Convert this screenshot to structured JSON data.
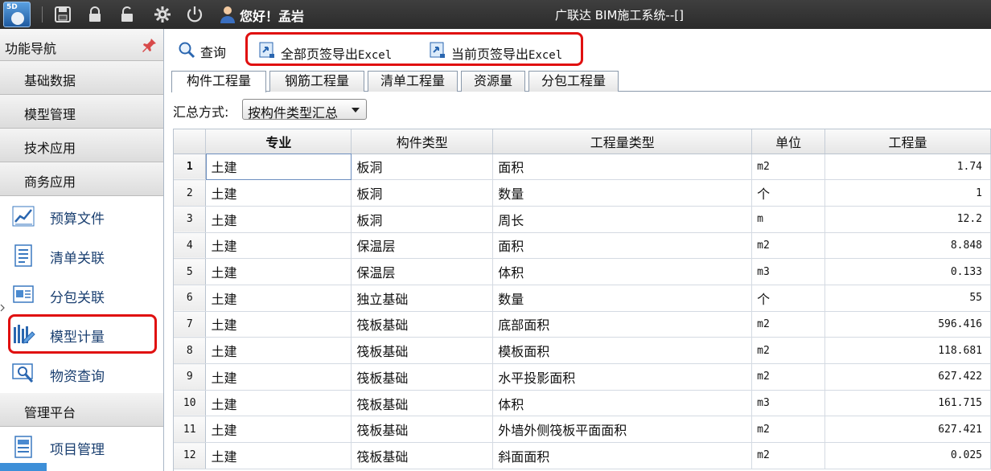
{
  "titlebar": {
    "logo_text": "5D",
    "greeting": "您好！孟岩",
    "app_title": "广联达 BIM施工系统--[]",
    "buttons": [
      "save-icon",
      "lock-icon",
      "unlock-icon",
      "gear-icon",
      "power-icon"
    ]
  },
  "sidebar": {
    "header": "功能导航",
    "sections": [
      {
        "label": "基础数据"
      },
      {
        "label": "模型管理"
      },
      {
        "label": "技术应用"
      },
      {
        "label": "商务应用"
      }
    ],
    "items": [
      {
        "label": "预算文件",
        "icon": "chart-icon"
      },
      {
        "label": "清单关联",
        "icon": "document-icon"
      },
      {
        "label": "分包关联",
        "icon": "presentation-icon"
      },
      {
        "label": "模型计量",
        "icon": "ruler-icon",
        "highlighted": true
      },
      {
        "label": "物资查询",
        "icon": "magnifier-icon"
      }
    ],
    "section2": {
      "label": "管理平台"
    },
    "items2": [
      {
        "label": "项目管理",
        "icon": "project-icon"
      }
    ]
  },
  "toolbar": {
    "query_label": "查询",
    "export_all": {
      "cn": "全部页签导出",
      "en": "Excel"
    },
    "export_current": {
      "cn": "当前页签导出",
      "en": "Excel"
    }
  },
  "tabs": [
    {
      "label": "构件工程量",
      "active": true
    },
    {
      "label": "钢筋工程量",
      "active": false
    },
    {
      "label": "清单工程量",
      "active": false
    },
    {
      "label": "资源量",
      "active": false
    },
    {
      "label": "分包工程量",
      "active": false
    }
  ],
  "filter": {
    "label": "汇总方式:",
    "selected": "按构件类型汇总"
  },
  "table": {
    "columns": [
      "专业",
      "构件类型",
      "工程量类型",
      "单位",
      "工程量"
    ],
    "rows": [
      {
        "n": "1",
        "major": "土建",
        "type": "板洞",
        "qtype": "面积",
        "unit": "m2",
        "qty": "1.74"
      },
      {
        "n": "2",
        "major": "土建",
        "type": "板洞",
        "qtype": "数量",
        "unit": "个",
        "qty": "1"
      },
      {
        "n": "3",
        "major": "土建",
        "type": "板洞",
        "qtype": "周长",
        "unit": "m",
        "qty": "12.2"
      },
      {
        "n": "4",
        "major": "土建",
        "type": "保温层",
        "qtype": "面积",
        "unit": "m2",
        "qty": "8.848"
      },
      {
        "n": "5",
        "major": "土建",
        "type": "保温层",
        "qtype": "体积",
        "unit": "m3",
        "qty": "0.133"
      },
      {
        "n": "6",
        "major": "土建",
        "type": "独立基础",
        "qtype": "数量",
        "unit": "个",
        "qty": "55"
      },
      {
        "n": "7",
        "major": "土建",
        "type": "筏板基础",
        "qtype": "底部面积",
        "unit": "m2",
        "qty": "596.416"
      },
      {
        "n": "8",
        "major": "土建",
        "type": "筏板基础",
        "qtype": "模板面积",
        "unit": "m2",
        "qty": "118.681"
      },
      {
        "n": "9",
        "major": "土建",
        "type": "筏板基础",
        "qtype": "水平投影面积",
        "unit": "m2",
        "qty": "627.422"
      },
      {
        "n": "10",
        "major": "土建",
        "type": "筏板基础",
        "qtype": "体积",
        "unit": "m3",
        "qty": "161.715"
      },
      {
        "n": "11",
        "major": "土建",
        "type": "筏板基础",
        "qtype": "外墙外侧筏板平面面积",
        "unit": "m2",
        "qty": "627.421"
      },
      {
        "n": "12",
        "major": "土建",
        "type": "筏板基础",
        "qtype": "斜面面积",
        "unit": "m2",
        "qty": "0.025"
      }
    ]
  },
  "colors": {
    "titlebar": "#333333",
    "highlight": "#e01010",
    "nav_text": "#1a3f70"
  }
}
